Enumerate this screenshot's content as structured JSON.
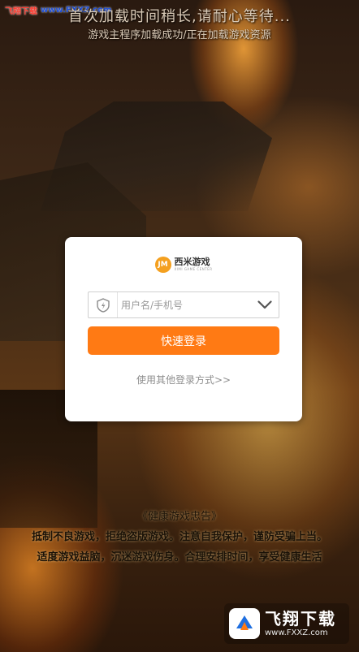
{
  "watermark_top": {
    "brand": "飞翔下载",
    "url": "www.FXXZ.com"
  },
  "loading": {
    "title": "首次加载时间稍长,请耐心等待...",
    "subtitle": "游戏主程序加载成功/正在加载游戏资源"
  },
  "login_card": {
    "brand_name": "西米游戏",
    "brand_tag": "XIMI GAME CENTER",
    "username_placeholder": "用户名/手机号",
    "login_button": "快速登录",
    "other_login_link": "使用其他登录方式>>"
  },
  "advisory": {
    "title": "《健康游戏忠告》",
    "line1": "抵制不良游戏，拒绝盗版游戏。注意自我保护，谨防受骗上当。",
    "line2": "适度游戏益脑，沉迷游戏伤身。合理安排时间，享受健康生活"
  },
  "watermark_bottom": {
    "brand": "飞翔下载",
    "site": "www.FXXZ.com"
  },
  "colors": {
    "accent": "#ff7a14",
    "brand_logo": "#f4a01f",
    "card_bg": "#ffffff",
    "link_gray": "#8f8f8f"
  },
  "icons": {
    "input_prefix": "shield-icon",
    "input_suffix": "chevron-down-icon"
  }
}
